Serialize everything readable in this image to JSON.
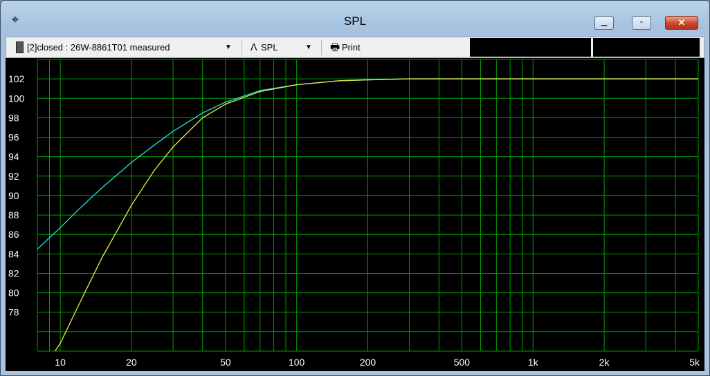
{
  "window": {
    "title": "SPL",
    "icons": {
      "app": "crosshair-icon",
      "minimize": "minimize-icon",
      "maximize": "maximize-icon",
      "close": "close-icon"
    }
  },
  "toolbar": {
    "driver_label": "[2]closed : 26W-8861T01 measured",
    "spl_label": "SPL",
    "print_label": "Print",
    "icons": {
      "driver": "speaker-file-icon",
      "dropdown": "dropdown-arrow-icon",
      "spl": "spl-curve-icon",
      "print": "printer-icon"
    }
  },
  "chart_data": {
    "type": "line",
    "x_scale": "log",
    "xlim": [
      8,
      5000
    ],
    "ylim": [
      74,
      104
    ],
    "x_ticks": [
      {
        "value": 10,
        "label": "10"
      },
      {
        "value": 20,
        "label": "20"
      },
      {
        "value": 50,
        "label": "50"
      },
      {
        "value": 100,
        "label": "100"
      },
      {
        "value": 200,
        "label": "200"
      },
      {
        "value": 500,
        "label": "500"
      },
      {
        "value": 1000,
        "label": "1k"
      },
      {
        "value": 2000,
        "label": "2k"
      },
      {
        "value": 5000,
        "label": "5k"
      }
    ],
    "y_ticks": [
      78,
      80,
      82,
      84,
      86,
      88,
      90,
      92,
      94,
      96,
      98,
      100,
      102
    ],
    "grid": true,
    "colors": {
      "background": "#000000",
      "grid": "#00a000",
      "series_cyan": "#22d8d0",
      "series_yellow": "#e0e040",
      "tick_text": "#ffffff"
    },
    "series": [
      {
        "color": "#22d8d0",
        "x": [
          8,
          10,
          12,
          15,
          20,
          25,
          30,
          40,
          50,
          70,
          100,
          150,
          200,
          300,
          500,
          1000,
          2000,
          5000
        ],
        "y": [
          84.5,
          86.7,
          88.6,
          90.8,
          93.4,
          95.2,
          96.6,
          98.5,
          99.6,
          100.8,
          101.4,
          101.8,
          101.9,
          102.0,
          102.0,
          102.0,
          102.0,
          102.0
        ]
      },
      {
        "color": "#e0e040",
        "x": [
          9.5,
          10,
          12,
          15,
          20,
          25,
          30,
          40,
          50,
          70,
          100,
          150,
          200,
          300,
          500,
          1000,
          2000,
          5000
        ],
        "y": [
          74,
          74.8,
          78.8,
          83.6,
          89.0,
          92.6,
          95.0,
          98.0,
          99.4,
          100.7,
          101.4,
          101.8,
          101.9,
          102.0,
          102.0,
          102.0,
          102.0,
          102.0
        ]
      }
    ]
  }
}
